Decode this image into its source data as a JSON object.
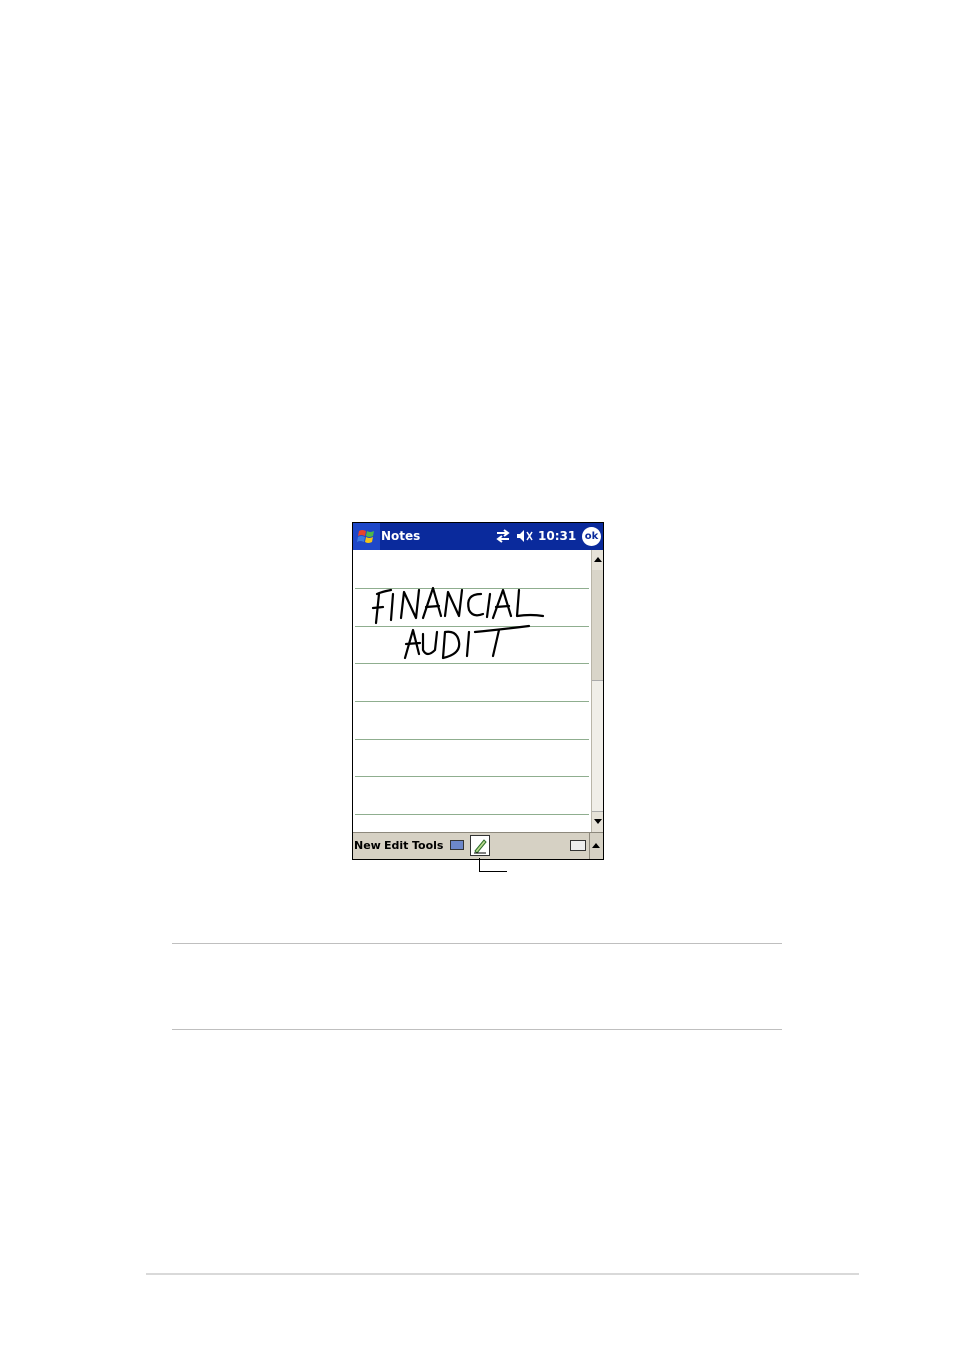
{
  "titlebar": {
    "start_icon": "windows-flag-icon",
    "app_title": "Notes",
    "sync_icon": "connectivity-arrows-icon",
    "volume_icon": "speaker-muted-icon",
    "clock": "10:31",
    "ok_label": "ok"
  },
  "note": {
    "handwriting_lines": [
      "FINANCIAL",
      "AUDIT"
    ]
  },
  "menubar": {
    "items": [
      "New",
      "Edit",
      "Tools"
    ],
    "recorder_icon": "recording-toolbar-icon",
    "pen_icon": "pen-icon",
    "keyboard_icon": "keyboard-icon",
    "sip_arrow_icon": "input-panel-arrow-icon"
  },
  "colors": {
    "titlebar": "#0a2a9c",
    "menubar": "#d6d1c4",
    "ruled_lines": "#8fae8f"
  }
}
